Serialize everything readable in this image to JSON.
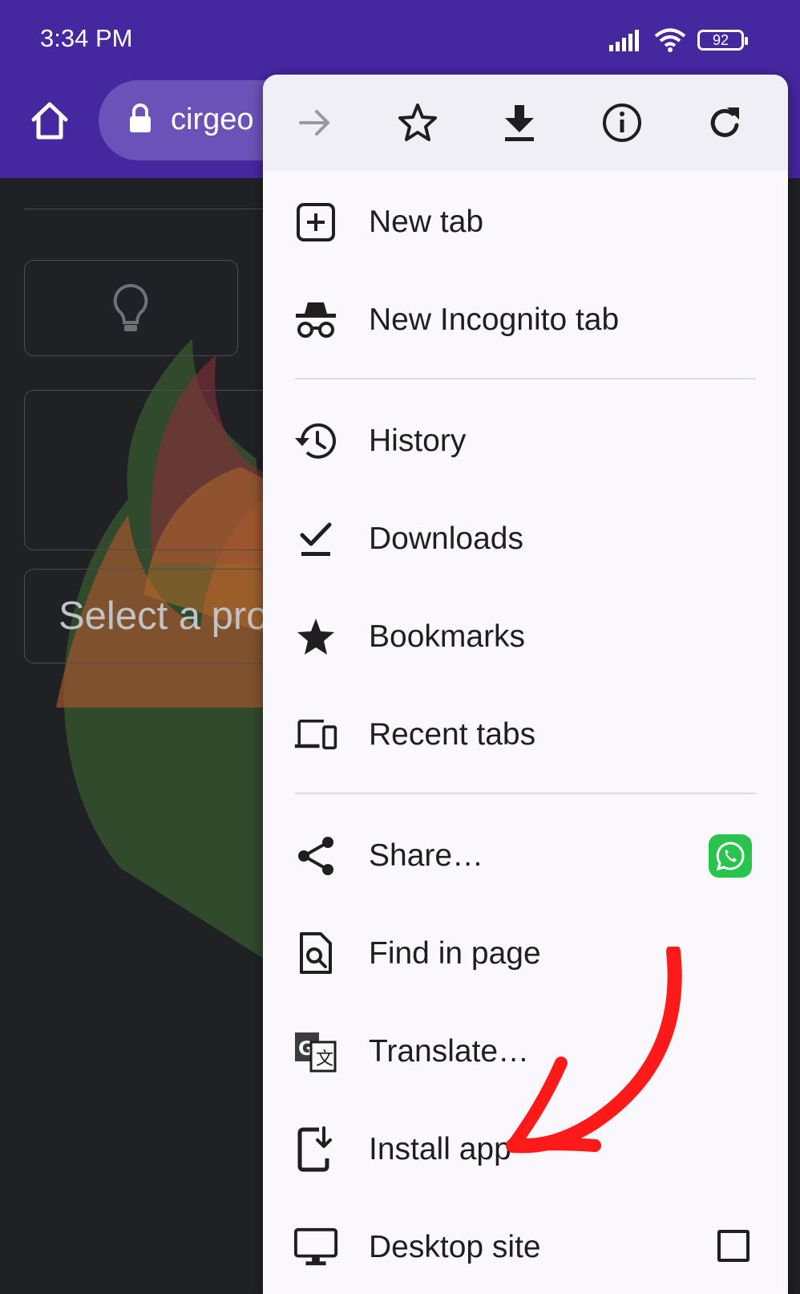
{
  "status_bar": {
    "time": "3:34 PM",
    "battery": "92",
    "icons": [
      "signal-icon",
      "wifi-icon",
      "battery-icon"
    ]
  },
  "toolbar": {
    "url": "cirgeo",
    "icons": [
      "home-icon",
      "lock-icon"
    ]
  },
  "page": {
    "select_placeholder": "Select a pro"
  },
  "menu": {
    "top_row": [
      {
        "name": "forward",
        "icon": "arrow-forward-icon"
      },
      {
        "name": "bookmark",
        "icon": "star-outline-icon"
      },
      {
        "name": "download",
        "icon": "download-icon"
      },
      {
        "name": "page-info",
        "icon": "info-icon"
      },
      {
        "name": "refresh",
        "icon": "refresh-icon"
      }
    ],
    "items": [
      {
        "label": "New tab",
        "icon": "add-box-icon"
      },
      {
        "label": "New Incognito tab",
        "icon": "incognito-icon"
      },
      {
        "label": "History",
        "icon": "history-icon"
      },
      {
        "label": "Downloads",
        "icon": "download-done-icon"
      },
      {
        "label": "Bookmarks",
        "icon": "star-icon"
      },
      {
        "label": "Recent tabs",
        "icon": "devices-icon"
      },
      {
        "label": "Share…",
        "icon": "share-icon"
      },
      {
        "label": "Find in page",
        "icon": "find-in-page-icon"
      },
      {
        "label": "Translate…",
        "icon": "translate-icon"
      },
      {
        "label": "Install app",
        "icon": "install-app-icon"
      },
      {
        "label": "Desktop site",
        "icon": "desktop-icon"
      }
    ],
    "share_target_icon": "whatsapp-icon",
    "desktop_site_checked": false
  },
  "colors": {
    "brand_toolbar": "#4527a0",
    "menu_background": "#fbf8fd",
    "annotation_arrow": "#ff1a1a",
    "whatsapp": "#29c44d"
  }
}
